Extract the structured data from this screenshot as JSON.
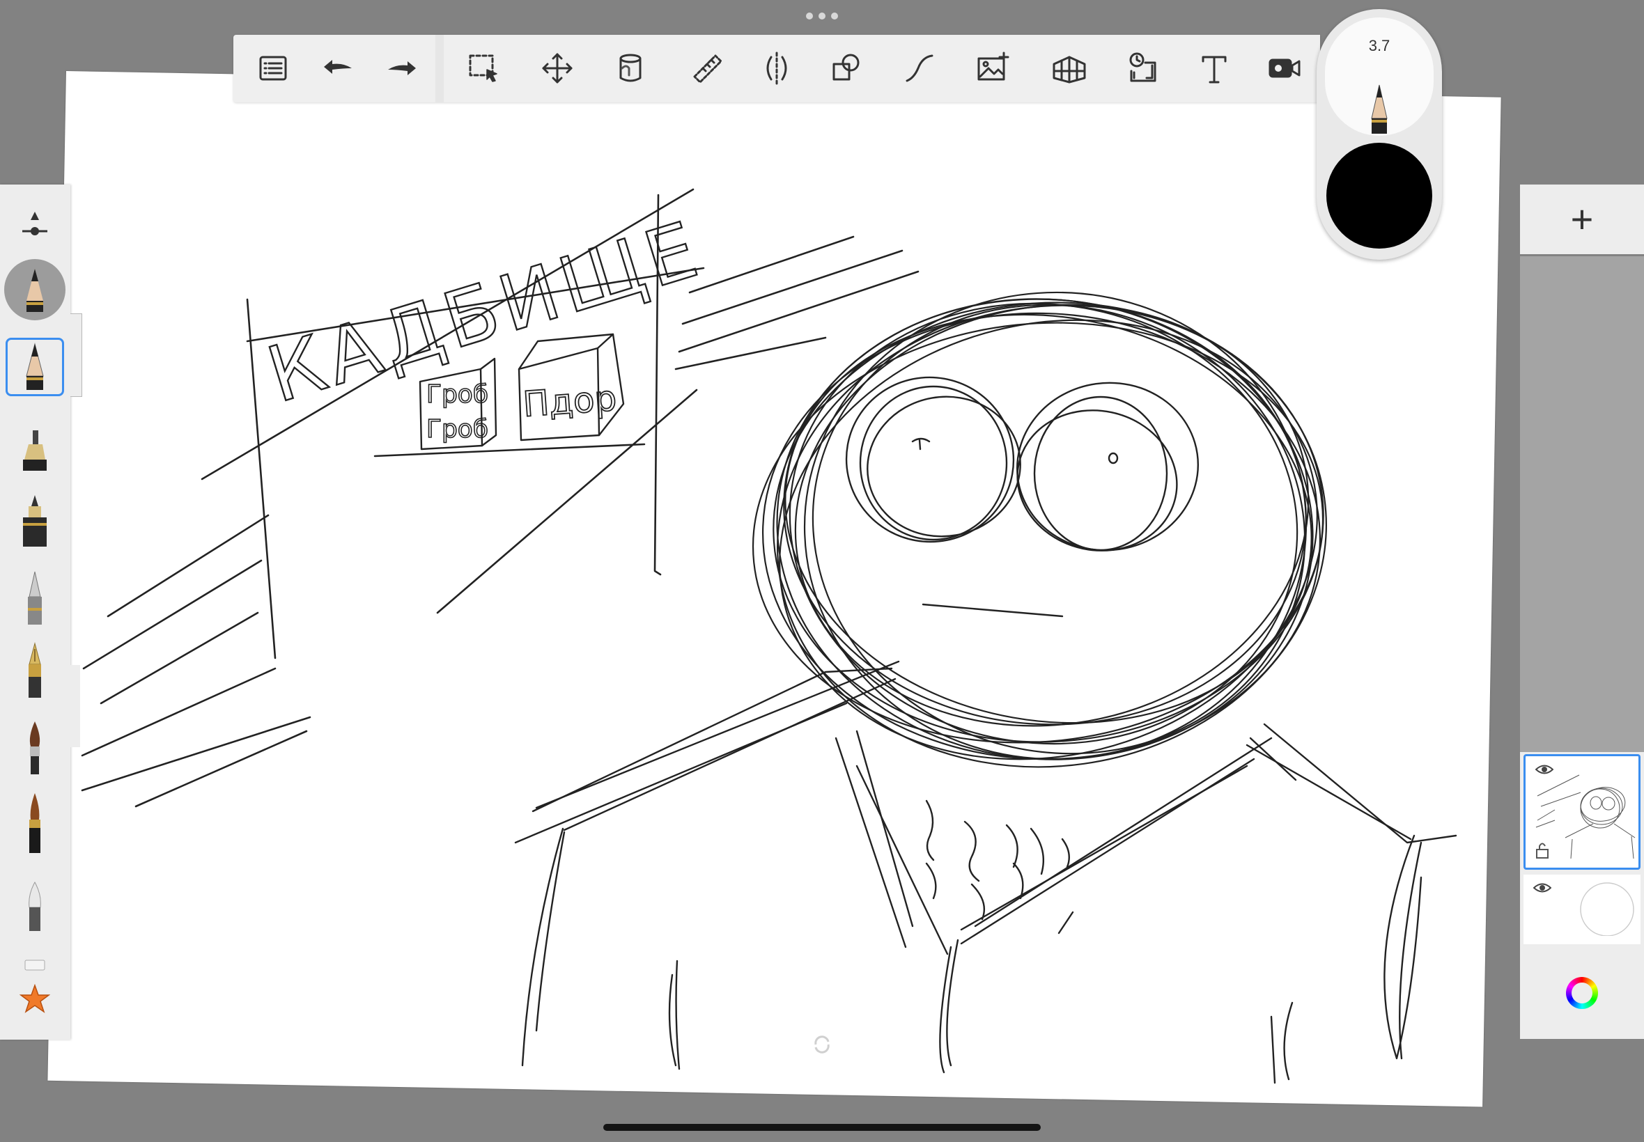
{
  "toolbar": {
    "items": [
      {
        "name": "menu-list-icon"
      },
      {
        "name": "undo-icon"
      },
      {
        "name": "redo-icon"
      },
      {
        "name": "selection-icon"
      },
      {
        "name": "transform-move-icon"
      },
      {
        "name": "fill-bucket-icon"
      },
      {
        "name": "ruler-icon"
      },
      {
        "name": "symmetry-icon"
      },
      {
        "name": "shapes-icon"
      },
      {
        "name": "curve-icon"
      },
      {
        "name": "add-image-icon"
      },
      {
        "name": "perspective-grid-icon"
      },
      {
        "name": "flipbook-icon"
      },
      {
        "name": "text-icon"
      },
      {
        "name": "record-icon"
      }
    ]
  },
  "brush": {
    "size": "3.7",
    "color": "#000000"
  },
  "brush_library": {
    "tools": [
      {
        "name": "size-slider-icon"
      },
      {
        "name": "pencil-brush-icon"
      },
      {
        "name": "marker-brush-icon"
      },
      {
        "name": "ink-pen-brush-icon"
      },
      {
        "name": "ballpoint-brush-icon"
      },
      {
        "name": "fountain-pen-brush-icon"
      },
      {
        "name": "paint-brush-icon"
      },
      {
        "name": "airbrush-icon"
      },
      {
        "name": "eraser-soft-icon"
      },
      {
        "name": "eraser-icon"
      },
      {
        "name": "favorite-star-icon"
      }
    ],
    "accent": "#3b8ef0",
    "star_color": "#f07a2a"
  },
  "layers": {
    "add_label": "+",
    "items": [
      {
        "name": "layer-1",
        "selected": true
      },
      {
        "name": "layer-2",
        "selected": false
      }
    ]
  },
  "sketch": {
    "sign_text": "КАДБИЩЕ",
    "box1_text": [
      "Гроб",
      "Гроб"
    ],
    "box2_text": "Пдор"
  }
}
